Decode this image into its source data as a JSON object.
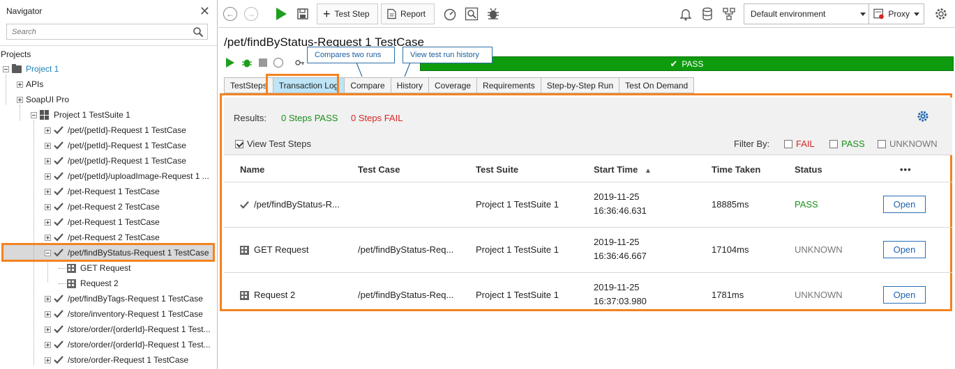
{
  "navigator": {
    "title": "Navigator",
    "search_placeholder": "Search",
    "projects_label": "Projects",
    "tree": [
      {
        "label": "Project 1",
        "kind": "project"
      },
      {
        "label": "APIs",
        "kind": "node"
      },
      {
        "label": "SoapUI Pro",
        "kind": "node"
      },
      {
        "label": "Project 1 TestSuite 1",
        "kind": "suite"
      },
      {
        "label": "/pet/{petId}-Request 1 TestCase",
        "kind": "case"
      },
      {
        "label": "/pet/{petId}-Request 1 TestCase",
        "kind": "case"
      },
      {
        "label": "/pet/{petId}-Request 1 TestCase",
        "kind": "case"
      },
      {
        "label": "/pet/{petId}/uploadImage-Request 1 ...",
        "kind": "case"
      },
      {
        "label": "/pet-Request 1 TestCase",
        "kind": "case"
      },
      {
        "label": "/pet-Request 2 TestCase",
        "kind": "case"
      },
      {
        "label": "/pet-Request 1 TestCase",
        "kind": "case"
      },
      {
        "label": "/pet-Request 2 TestCase",
        "kind": "case"
      },
      {
        "label": "/pet/findByStatus-Request 1 TestCase",
        "kind": "case-selected"
      },
      {
        "label": "GET Request",
        "kind": "step"
      },
      {
        "label": "Request 2",
        "kind": "step"
      },
      {
        "label": "/pet/findByTags-Request 1 TestCase",
        "kind": "case"
      },
      {
        "label": "/store/inventory-Request 1 TestCase",
        "kind": "case"
      },
      {
        "label": "/store/order/{orderId}-Request 1 Test...",
        "kind": "case"
      },
      {
        "label": "/store/order/{orderId}-Request 1 Test...",
        "kind": "case"
      },
      {
        "label": "/store/order-Request 1 TestCase",
        "kind": "case"
      }
    ]
  },
  "toolbar": {
    "test_step_label": "Test Step",
    "report_label": "Report",
    "environment": "Default environment",
    "proxy_label": "Proxy"
  },
  "testcase": {
    "title": "/pet/findByStatus-Request 1 TestCase",
    "status_bar": "PASS",
    "tooltip_compare": "Compares two runs",
    "tooltip_history": "View test run history",
    "tabs": [
      "TestSteps",
      "Transaction Log",
      "Compare",
      "History",
      "Coverage",
      "Requirements",
      "Step-by-Step Run",
      "Test On Demand"
    ],
    "active_tab": "Transaction Log"
  },
  "transaction_log": {
    "results_label": "Results:",
    "steps_pass": "0 Steps PASS",
    "steps_fail": "0 Steps FAIL",
    "view_test_steps_label": "View Test Steps",
    "view_test_steps_checked": true,
    "filter_by_label": "Filter By:",
    "filters": [
      {
        "label": "FAIL",
        "checked": false,
        "color": "#d62626"
      },
      {
        "label": "PASS",
        "checked": false,
        "color": "#1a8f1a"
      },
      {
        "label": "UNKNOWN",
        "checked": false,
        "color": "#777777"
      }
    ],
    "columns": [
      "Name",
      "Test Case",
      "Test Suite",
      "Start Time",
      "Time Taken",
      "Status",
      "•••"
    ],
    "sort_column": "Start Time",
    "rows": [
      {
        "icon": "check-icon",
        "name": "/pet/findByStatus-R...",
        "test_case": "",
        "test_suite": "Project 1 TestSuite 1",
        "start_date": "2019-11-25",
        "start_time": "16:36:46.631",
        "time_taken": "18885ms",
        "status": "PASS",
        "action": "Open"
      },
      {
        "icon": "request-step-icon",
        "name": "GET Request",
        "test_case": "/pet/findByStatus-Req...",
        "test_suite": "Project 1 TestSuite 1",
        "start_date": "2019-11-25",
        "start_time": "16:36:46.667",
        "time_taken": "17104ms",
        "status": "UNKNOWN",
        "action": "Open"
      },
      {
        "icon": "request-step-icon",
        "name": "Request 2",
        "test_case": "/pet/findByStatus-Req...",
        "test_suite": "Project 1 TestSuite 1",
        "start_date": "2019-11-25",
        "start_time": "16:37:03.980",
        "time_taken": "1781ms",
        "status": "UNKNOWN",
        "action": "Open"
      }
    ],
    "status_colors": {
      "PASS": "#1a8f1a",
      "UNKNOWN": "#777777"
    }
  },
  "colors": {
    "accent_highlight": "#f58220",
    "pass_green": "#0e9b0e",
    "link_blue": "#1e63b0"
  }
}
